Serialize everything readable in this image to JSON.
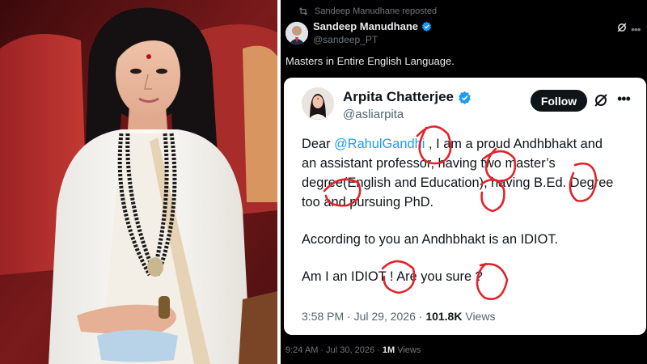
{
  "reposter": {
    "icon": "repost-icon",
    "label": "Sandeep Manudhane reposted"
  },
  "outer_tweet": {
    "author_name": "Sandeep Manudhane",
    "author_handle": "@sandeep_PT",
    "text": "Masters in Entire English Language.",
    "timestamp": "9:24 AM · Jul 30, 2026 · ",
    "views_count": "1M",
    "views_label": " Views"
  },
  "quoted_tweet": {
    "author_name": "Arpita Chatterjee",
    "author_handle": "@asliarpita",
    "follow_label": "Follow",
    "line1_prefix": "Dear ",
    "mention": "@RahulGandhi",
    "line1_suffix": " , I am a proud Andhbhakt and",
    "line2": "an assistant professor, having two master’s",
    "line3": "degree(English and Education), having B.Ed. Degree",
    "line4": "too and pursuing PhD.",
    "line5": "According to you an Andhbhakt is an IDIOT.",
    "line6": "Am I an IDIOT ! Are you sure ?",
    "timestamp": "3:58 PM · Jul 29, 2026 · ",
    "views_count": "101.8K",
    "views_label": " Views"
  },
  "colors": {
    "accent_blue": "#1d9bf0",
    "annotation_red": "#e0242b",
    "dark_bg": "#000000"
  }
}
